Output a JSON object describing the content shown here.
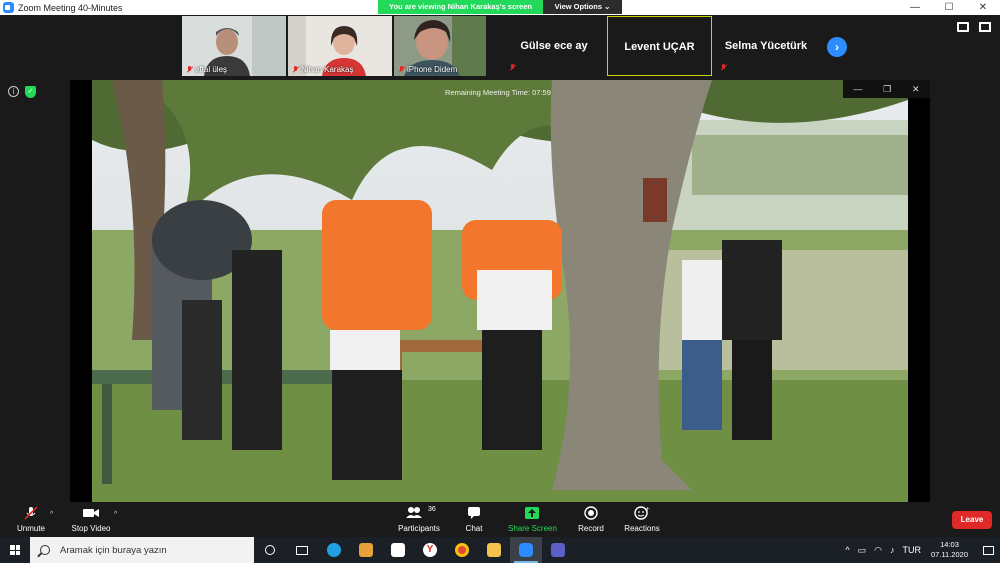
{
  "window": {
    "title": "Zoom Meeting 40-Minutes",
    "controls": [
      "—",
      "☐",
      "✕"
    ]
  },
  "share_banner": {
    "viewing_text": "You are viewing Nihan Karakaş's screen",
    "view_options": "View Options ⌄"
  },
  "participants_strip": [
    {
      "name": "eftal üleş",
      "type": "video",
      "muted": true
    },
    {
      "name": "Nihan Karakaş",
      "type": "video",
      "muted": true
    },
    {
      "name": "iPhone Didem",
      "type": "video",
      "muted": true
    },
    {
      "name": "Gülse ece ay",
      "type": "name",
      "muted": true
    },
    {
      "name": "Levent UÇAR",
      "type": "name",
      "muted": false,
      "active": true
    },
    {
      "name": "Selma Yücetürk",
      "type": "name",
      "muted": true
    }
  ],
  "shared_screen": {
    "remaining_time_text": "Remaining Meeting Time: 07:59",
    "mini_controls": [
      "—",
      "❐",
      "✕"
    ]
  },
  "toolbar": {
    "unmute": "Unmute",
    "stop_video": "Stop Video",
    "participants": "Participants",
    "participants_count": "36",
    "chat": "Chat",
    "share_screen": "Share Screen",
    "record": "Record",
    "reactions": "Reactions",
    "leave": "Leave"
  },
  "taskbar": {
    "search_placeholder": "Aramak için buraya yazın",
    "language": "TUR",
    "time": "14:03",
    "date": "07.11.2020"
  },
  "colors": {
    "zoom_blue": "#2d8cff",
    "share_green": "#23d959",
    "leave_red": "#e02828",
    "active_speaker": "#c6d400"
  }
}
